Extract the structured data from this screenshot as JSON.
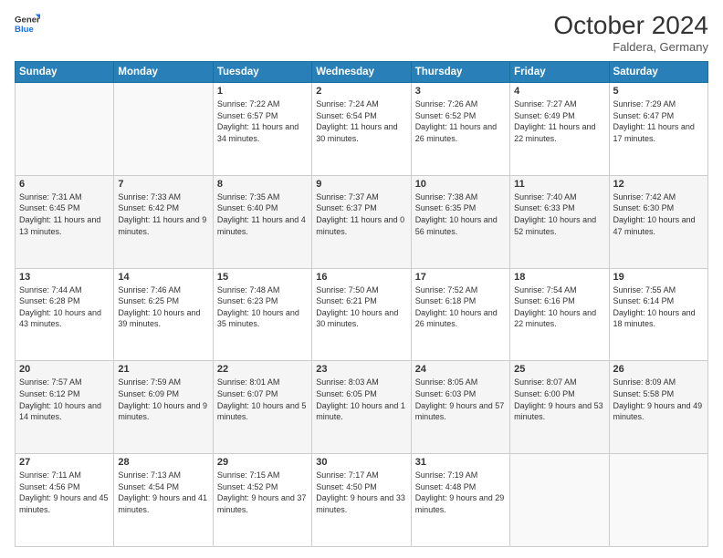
{
  "header": {
    "logo_line1": "General",
    "logo_line2": "Blue",
    "month": "October 2024",
    "location": "Faldera, Germany"
  },
  "days_of_week": [
    "Sunday",
    "Monday",
    "Tuesday",
    "Wednesday",
    "Thursday",
    "Friday",
    "Saturday"
  ],
  "weeks": [
    [
      {
        "day": "",
        "sunrise": "",
        "sunset": "",
        "daylight": ""
      },
      {
        "day": "",
        "sunrise": "",
        "sunset": "",
        "daylight": ""
      },
      {
        "day": "1",
        "sunrise": "Sunrise: 7:22 AM",
        "sunset": "Sunset: 6:57 PM",
        "daylight": "Daylight: 11 hours and 34 minutes."
      },
      {
        "day": "2",
        "sunrise": "Sunrise: 7:24 AM",
        "sunset": "Sunset: 6:54 PM",
        "daylight": "Daylight: 11 hours and 30 minutes."
      },
      {
        "day": "3",
        "sunrise": "Sunrise: 7:26 AM",
        "sunset": "Sunset: 6:52 PM",
        "daylight": "Daylight: 11 hours and 26 minutes."
      },
      {
        "day": "4",
        "sunrise": "Sunrise: 7:27 AM",
        "sunset": "Sunset: 6:49 PM",
        "daylight": "Daylight: 11 hours and 22 minutes."
      },
      {
        "day": "5",
        "sunrise": "Sunrise: 7:29 AM",
        "sunset": "Sunset: 6:47 PM",
        "daylight": "Daylight: 11 hours and 17 minutes."
      }
    ],
    [
      {
        "day": "6",
        "sunrise": "Sunrise: 7:31 AM",
        "sunset": "Sunset: 6:45 PM",
        "daylight": "Daylight: 11 hours and 13 minutes."
      },
      {
        "day": "7",
        "sunrise": "Sunrise: 7:33 AM",
        "sunset": "Sunset: 6:42 PM",
        "daylight": "Daylight: 11 hours and 9 minutes."
      },
      {
        "day": "8",
        "sunrise": "Sunrise: 7:35 AM",
        "sunset": "Sunset: 6:40 PM",
        "daylight": "Daylight: 11 hours and 4 minutes."
      },
      {
        "day": "9",
        "sunrise": "Sunrise: 7:37 AM",
        "sunset": "Sunset: 6:37 PM",
        "daylight": "Daylight: 11 hours and 0 minutes."
      },
      {
        "day": "10",
        "sunrise": "Sunrise: 7:38 AM",
        "sunset": "Sunset: 6:35 PM",
        "daylight": "Daylight: 10 hours and 56 minutes."
      },
      {
        "day": "11",
        "sunrise": "Sunrise: 7:40 AM",
        "sunset": "Sunset: 6:33 PM",
        "daylight": "Daylight: 10 hours and 52 minutes."
      },
      {
        "day": "12",
        "sunrise": "Sunrise: 7:42 AM",
        "sunset": "Sunset: 6:30 PM",
        "daylight": "Daylight: 10 hours and 47 minutes."
      }
    ],
    [
      {
        "day": "13",
        "sunrise": "Sunrise: 7:44 AM",
        "sunset": "Sunset: 6:28 PM",
        "daylight": "Daylight: 10 hours and 43 minutes."
      },
      {
        "day": "14",
        "sunrise": "Sunrise: 7:46 AM",
        "sunset": "Sunset: 6:25 PM",
        "daylight": "Daylight: 10 hours and 39 minutes."
      },
      {
        "day": "15",
        "sunrise": "Sunrise: 7:48 AM",
        "sunset": "Sunset: 6:23 PM",
        "daylight": "Daylight: 10 hours and 35 minutes."
      },
      {
        "day": "16",
        "sunrise": "Sunrise: 7:50 AM",
        "sunset": "Sunset: 6:21 PM",
        "daylight": "Daylight: 10 hours and 30 minutes."
      },
      {
        "day": "17",
        "sunrise": "Sunrise: 7:52 AM",
        "sunset": "Sunset: 6:18 PM",
        "daylight": "Daylight: 10 hours and 26 minutes."
      },
      {
        "day": "18",
        "sunrise": "Sunrise: 7:54 AM",
        "sunset": "Sunset: 6:16 PM",
        "daylight": "Daylight: 10 hours and 22 minutes."
      },
      {
        "day": "19",
        "sunrise": "Sunrise: 7:55 AM",
        "sunset": "Sunset: 6:14 PM",
        "daylight": "Daylight: 10 hours and 18 minutes."
      }
    ],
    [
      {
        "day": "20",
        "sunrise": "Sunrise: 7:57 AM",
        "sunset": "Sunset: 6:12 PM",
        "daylight": "Daylight: 10 hours and 14 minutes."
      },
      {
        "day": "21",
        "sunrise": "Sunrise: 7:59 AM",
        "sunset": "Sunset: 6:09 PM",
        "daylight": "Daylight: 10 hours and 9 minutes."
      },
      {
        "day": "22",
        "sunrise": "Sunrise: 8:01 AM",
        "sunset": "Sunset: 6:07 PM",
        "daylight": "Daylight: 10 hours and 5 minutes."
      },
      {
        "day": "23",
        "sunrise": "Sunrise: 8:03 AM",
        "sunset": "Sunset: 6:05 PM",
        "daylight": "Daylight: 10 hours and 1 minute."
      },
      {
        "day": "24",
        "sunrise": "Sunrise: 8:05 AM",
        "sunset": "Sunset: 6:03 PM",
        "daylight": "Daylight: 9 hours and 57 minutes."
      },
      {
        "day": "25",
        "sunrise": "Sunrise: 8:07 AM",
        "sunset": "Sunset: 6:00 PM",
        "daylight": "Daylight: 9 hours and 53 minutes."
      },
      {
        "day": "26",
        "sunrise": "Sunrise: 8:09 AM",
        "sunset": "Sunset: 5:58 PM",
        "daylight": "Daylight: 9 hours and 49 minutes."
      }
    ],
    [
      {
        "day": "27",
        "sunrise": "Sunrise: 7:11 AM",
        "sunset": "Sunset: 4:56 PM",
        "daylight": "Daylight: 9 hours and 45 minutes."
      },
      {
        "day": "28",
        "sunrise": "Sunrise: 7:13 AM",
        "sunset": "Sunset: 4:54 PM",
        "daylight": "Daylight: 9 hours and 41 minutes."
      },
      {
        "day": "29",
        "sunrise": "Sunrise: 7:15 AM",
        "sunset": "Sunset: 4:52 PM",
        "daylight": "Daylight: 9 hours and 37 minutes."
      },
      {
        "day": "30",
        "sunrise": "Sunrise: 7:17 AM",
        "sunset": "Sunset: 4:50 PM",
        "daylight": "Daylight: 9 hours and 33 minutes."
      },
      {
        "day": "31",
        "sunrise": "Sunrise: 7:19 AM",
        "sunset": "Sunset: 4:48 PM",
        "daylight": "Daylight: 9 hours and 29 minutes."
      },
      {
        "day": "",
        "sunrise": "",
        "sunset": "",
        "daylight": ""
      },
      {
        "day": "",
        "sunrise": "",
        "sunset": "",
        "daylight": ""
      }
    ]
  ]
}
